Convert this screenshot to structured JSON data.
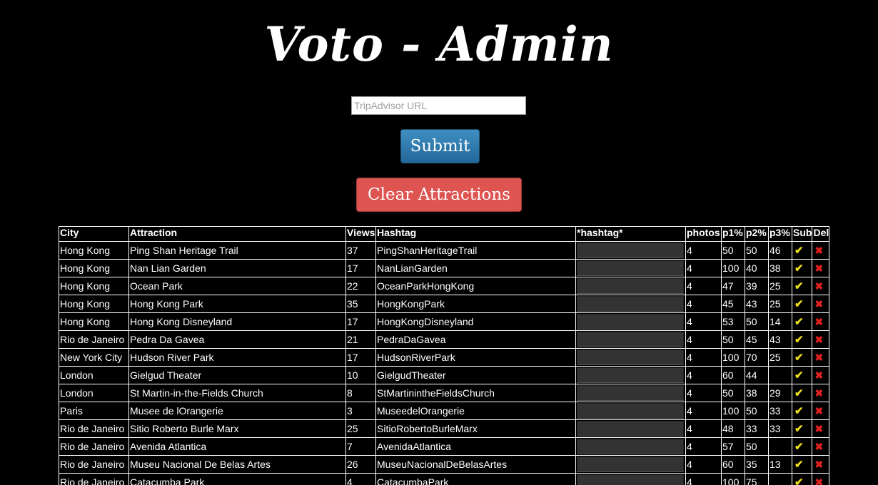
{
  "header": {
    "title": "Voto - Admin"
  },
  "form": {
    "url_placeholder": "TripAdvisor URL",
    "url_value": "",
    "submit_label": "Submit",
    "clear_label": "Clear Attractions"
  },
  "table": {
    "headers": [
      "City",
      "Attraction",
      "Views",
      "Hashtag",
      "*hashtag*",
      "photos",
      "p1%",
      "p2%",
      "p3%",
      "Sub",
      "Del"
    ],
    "rows": [
      {
        "city": "Hong Kong",
        "attraction": "Ping Shan Heritage Trail",
        "views": "37",
        "hashtag": "PingShanHeritageTrail",
        "photos": "4",
        "p1": "50",
        "p2": "50",
        "p3": "46"
      },
      {
        "city": "Hong Kong",
        "attraction": "Nan Lian Garden",
        "views": "17",
        "hashtag": "NanLianGarden",
        "photos": "4",
        "p1": "100",
        "p2": "40",
        "p3": "38"
      },
      {
        "city": "Hong Kong",
        "attraction": "Ocean Park",
        "views": "22",
        "hashtag": "OceanParkHongKong",
        "photos": "4",
        "p1": "47",
        "p2": "39",
        "p3": "25"
      },
      {
        "city": "Hong Kong",
        "attraction": "Hong Kong Park",
        "views": "35",
        "hashtag": "HongKongPark",
        "photos": "4",
        "p1": "45",
        "p2": "43",
        "p3": "25"
      },
      {
        "city": "Hong Kong",
        "attraction": "Hong Kong Disneyland",
        "views": "17",
        "hashtag": "HongKongDisneyland",
        "photos": "4",
        "p1": "53",
        "p2": "50",
        "p3": "14"
      },
      {
        "city": "Rio de Janeiro",
        "attraction": "Pedra Da Gavea",
        "views": "21",
        "hashtag": "PedraDaGavea",
        "photos": "4",
        "p1": "50",
        "p2": "45",
        "p3": "43"
      },
      {
        "city": "New York City",
        "attraction": "Hudson River Park",
        "views": "17",
        "hashtag": "HudsonRiverPark",
        "photos": "4",
        "p1": "100",
        "p2": "70",
        "p3": "25"
      },
      {
        "city": "London",
        "attraction": "Gielgud Theater",
        "views": "10",
        "hashtag": "GielgudTheater",
        "photos": "4",
        "p1": "60",
        "p2": "44",
        "p3": ""
      },
      {
        "city": "London",
        "attraction": "St Martin-in-the-Fields Church",
        "views": "8",
        "hashtag": "StMartinintheFieldsChurch",
        "photos": "4",
        "p1": "50",
        "p2": "38",
        "p3": "29"
      },
      {
        "city": "Paris",
        "attraction": "Musee de lOrangerie",
        "views": "3",
        "hashtag": "MuseedelOrangerie",
        "photos": "4",
        "p1": "100",
        "p2": "50",
        "p3": "33"
      },
      {
        "city": "Rio de Janeiro",
        "attraction": "Sitio Roberto Burle Marx",
        "views": "25",
        "hashtag": "SitioRobertoBurleMarx",
        "photos": "4",
        "p1": "48",
        "p2": "33",
        "p3": "33"
      },
      {
        "city": "Rio de Janeiro",
        "attraction": "Avenida Atlantica",
        "views": "7",
        "hashtag": "AvenidaAtlantica",
        "photos": "4",
        "p1": "57",
        "p2": "50",
        "p3": ""
      },
      {
        "city": "Rio de Janeiro",
        "attraction": "Museu Nacional De Belas Artes",
        "views": "26",
        "hashtag": "MuseuNacionalDeBelasArtes",
        "photos": "4",
        "p1": "60",
        "p2": "35",
        "p3": "13"
      },
      {
        "city": "Rio de Janeiro",
        "attraction": "Catacumba Park",
        "views": "4",
        "hashtag": "CatacumbaPark",
        "photos": "4",
        "p1": "100",
        "p2": "75",
        "p3": ""
      }
    ],
    "sub_icon": "check-icon",
    "del_icon": "x-icon",
    "sub_glyph": "✔",
    "del_glyph": "✖"
  },
  "colors": {
    "background": "#000000",
    "submit_button": "#2f7fb5",
    "clear_button": "#dd5451",
    "check": "#f0e020",
    "delete": "#e02020"
  }
}
